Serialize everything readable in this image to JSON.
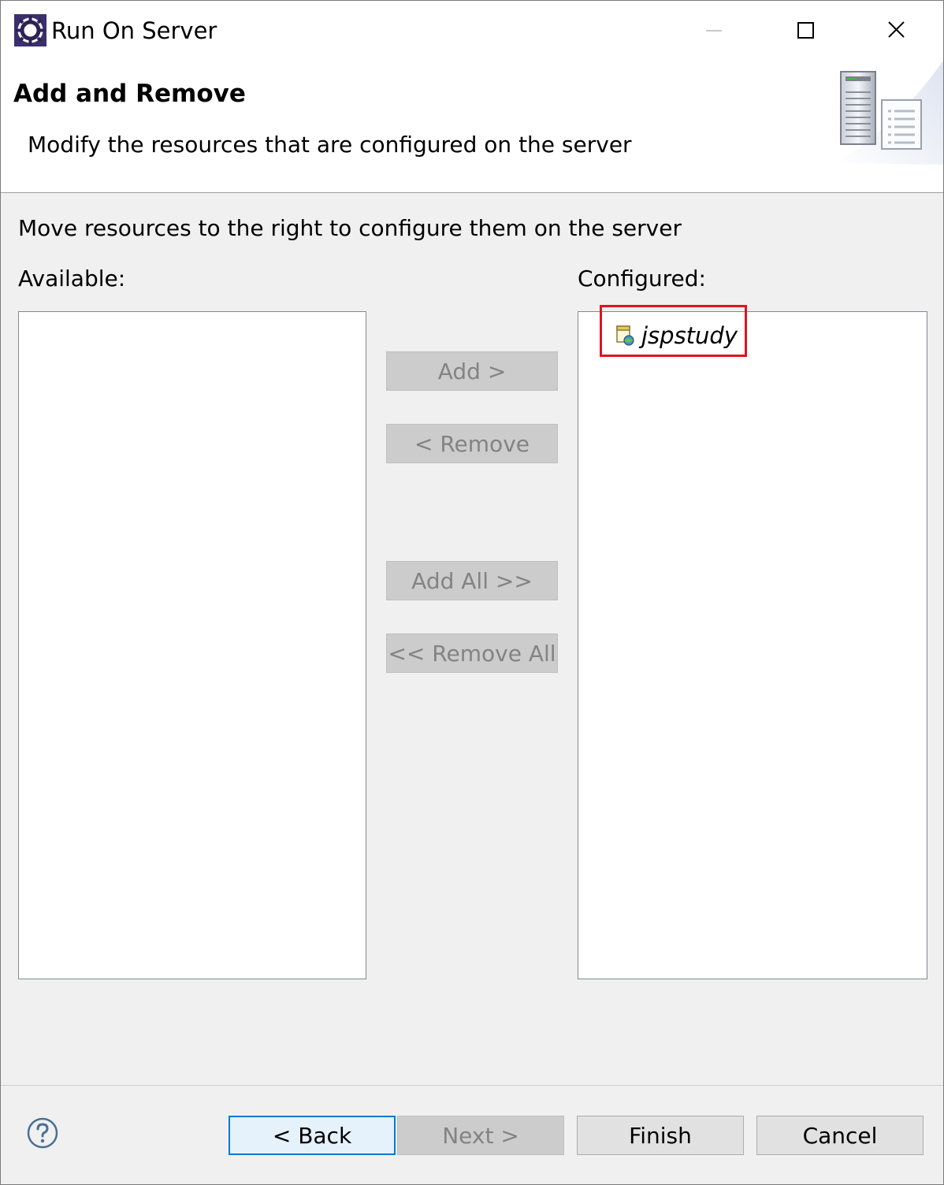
{
  "window": {
    "title": "Run On Server"
  },
  "banner": {
    "title": "Add and Remove",
    "description": "Modify the resources that are configured on the server"
  },
  "main": {
    "instruction": "Move resources to the right to configure them on the server",
    "available_label": "Available:",
    "configured_label": "Configured:",
    "available_items": [],
    "configured_items": [
      {
        "label": "jspstudy",
        "icon": "web-project-icon"
      }
    ]
  },
  "transfer_buttons": {
    "add": "Add >",
    "remove": "< Remove",
    "add_all": "Add All >>",
    "remove_all": "<< Remove All"
  },
  "footer": {
    "back": "< Back",
    "next": "Next >",
    "finish": "Finish",
    "cancel": "Cancel"
  },
  "colors": {
    "highlight": "#e0141e",
    "default_button_border": "#0078d7"
  }
}
